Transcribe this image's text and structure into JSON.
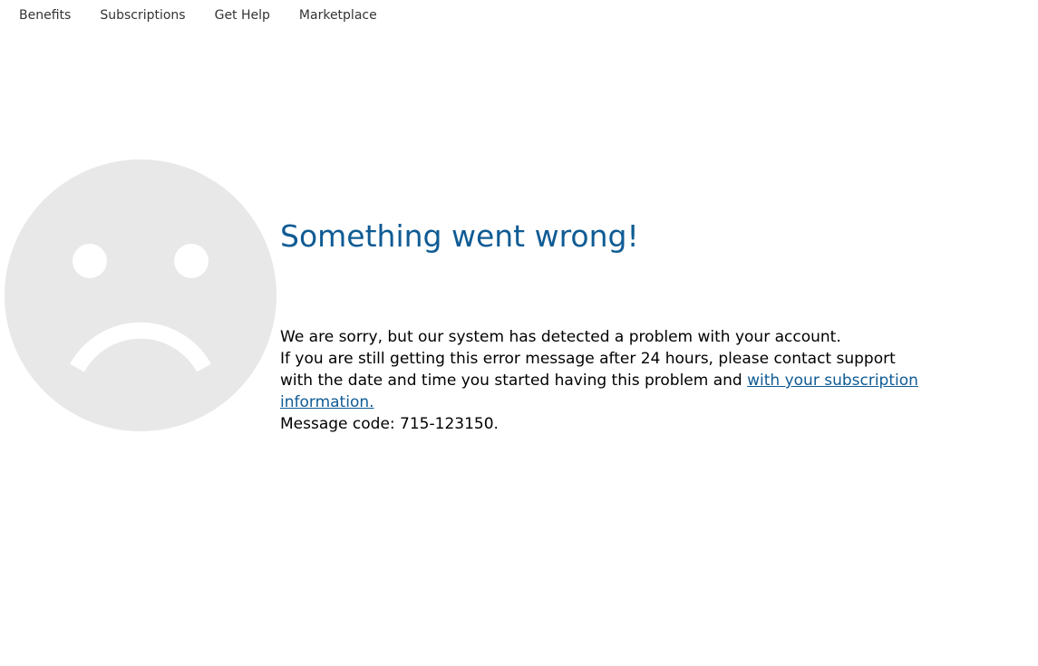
{
  "nav": {
    "items": [
      {
        "label": "Benefits"
      },
      {
        "label": "Subscriptions"
      },
      {
        "label": "Get Help"
      },
      {
        "label": "Marketplace"
      }
    ]
  },
  "error": {
    "icon": "sad-face-icon",
    "title": "Something went wrong!",
    "line1": "We are sorry, but our system has detected a problem with your account.",
    "line2_text": "If you are still getting this error message after 24 hours, please contact support with the date and time you started having this problem and ",
    "link_text": "with your subscription information.",
    "message_code": "Message code: 715-123150."
  },
  "colors": {
    "title": "#0f5b94",
    "link": "#0f5b94",
    "face": "#e8e8e8"
  }
}
